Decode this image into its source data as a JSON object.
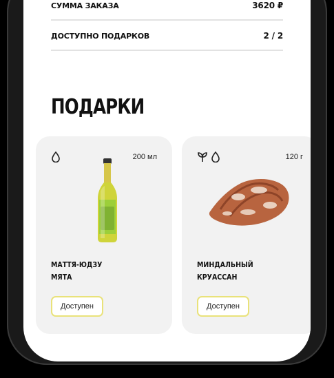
{
  "summary": {
    "order_total_label": "СУММА ЗАКАЗА",
    "order_total_value": "3620 ₽",
    "gifts_available_label": "ДОСТУПНО ПОДАРКОВ",
    "gifts_available_value": "2 / 2"
  },
  "gifts_section": {
    "title": "ПОДАРКИ",
    "items": [
      {
        "icons": [
          "drop-icon"
        ],
        "amount": "200 мл",
        "name": "МАТТЯ-ЮДЗУ\nМЯТА",
        "status": "Доступен",
        "image": "bottle-image"
      },
      {
        "icons": [
          "leaf-icon",
          "drop-icon"
        ],
        "amount": "120 г",
        "name": "МИНДАЛЬНЫЙ\nКРУАССАН",
        "status": "Доступен",
        "image": "croissant-image"
      }
    ]
  },
  "colors": {
    "background": "#000000",
    "screen": "#ffffff",
    "card": "#f2f2f2",
    "status_border": "#e9e27a",
    "divider": "#e2e2e2"
  }
}
